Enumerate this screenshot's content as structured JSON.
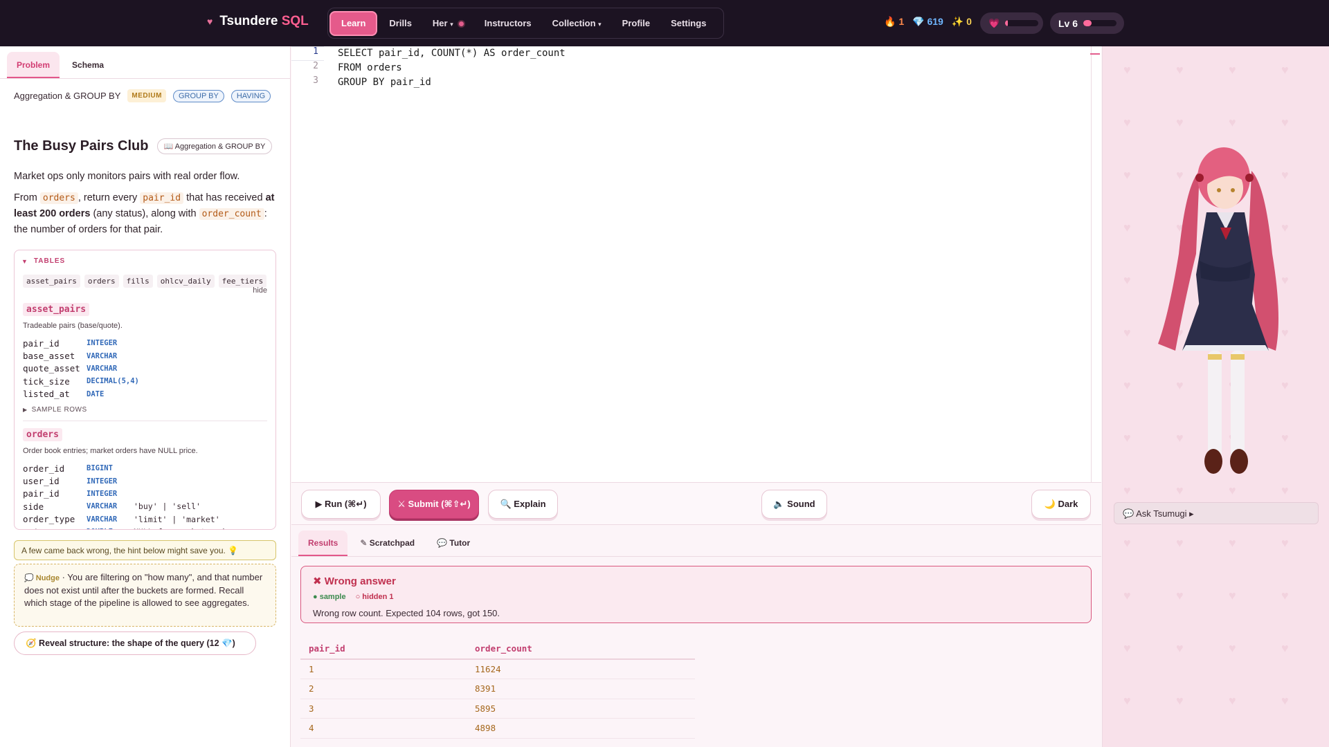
{
  "brand": {
    "name": "Tsundere",
    "suffix": "SQL"
  },
  "nav": {
    "items": [
      "Learn",
      "Drills",
      "Her",
      "Instructors",
      "Collection",
      "Profile",
      "Settings"
    ],
    "active": "Learn"
  },
  "stats": {
    "streak": "1",
    "gems": "619",
    "sparkles": "0"
  },
  "affection": {
    "fraction": 0.08
  },
  "level": {
    "label": "Lv 6",
    "fraction": 0.25
  },
  "left": {
    "tabs": [
      "Problem",
      "Schema"
    ],
    "topic": "Aggregation & GROUP BY",
    "difficulty": "MEDIUM",
    "tags": [
      "GROUP BY",
      "HAVING"
    ],
    "title": "The Busy Pairs Club",
    "topic_badge": "📖 Aggregation & GROUP BY",
    "desc1": "Market ops only monitors pairs with real order flow.",
    "desc2": {
      "from": "From",
      "code1": "orders",
      "mid": ", return every",
      "code2": "pair_id",
      "rest": "that has received",
      "bold": "at least 200 orders",
      "after": "(any status), along with",
      "code3": "order_count",
      "end": ": the number of orders for that pair."
    },
    "tables_header": "TABLES",
    "table_chips": [
      "asset_pairs",
      "orders",
      "fills",
      "ohlcv_daily",
      "fee_tiers"
    ],
    "hide": "hide",
    "t1": {
      "name": "asset_pairs",
      "desc": "Tradeable pairs (base/quote).",
      "cols": [
        [
          "pair_id",
          "INTEGER",
          ""
        ],
        [
          "base_asset",
          "VARCHAR",
          ""
        ],
        [
          "quote_asset",
          "VARCHAR",
          ""
        ],
        [
          "tick_size",
          "DECIMAL(5,4)",
          ""
        ],
        [
          "listed_at",
          "DATE",
          ""
        ]
      ]
    },
    "sample_rows": "SAMPLE ROWS",
    "t2": {
      "name": "orders",
      "desc": "Order book entries; market orders have NULL price.",
      "cols": [
        [
          "order_id",
          "BIGINT",
          ""
        ],
        [
          "user_id",
          "INTEGER",
          ""
        ],
        [
          "pair_id",
          "INTEGER",
          ""
        ],
        [
          "side",
          "VARCHAR",
          "'buy' | 'sell'"
        ],
        [
          "order_type",
          "VARCHAR",
          "'limit' | 'market'"
        ],
        [
          "price",
          "DOUBLE",
          "NULL for market orders"
        ]
      ]
    },
    "warn": "A few came back wrong, the hint below might save you. 💡",
    "nudge_label": "💭 Nudge",
    "nudge": " · You are filtering on \"how many\", and that number does not exist until after the buckets are formed. Recall which stage of the pipeline is allowed to see aggregates.",
    "reveal": "🧭 Reveal structure: the shape of the query (12 💎)"
  },
  "editor": {
    "lines": [
      "SELECT pair_id, COUNT(*) AS order_count",
      "FROM orders",
      "GROUP BY pair_id"
    ],
    "line_numbers": [
      "1",
      "2",
      "3"
    ]
  },
  "toolbar": {
    "run": "▶ Run (⌘↵)",
    "submit": "⚔ Submit (⌘⇧↵)",
    "explain": "🔍 Explain",
    "sound": "🔈 Sound",
    "dark": "🌙 Dark"
  },
  "results": {
    "tabs": [
      "Results",
      "✎ Scratchpad",
      "💬 Tutor"
    ],
    "status": "✖ Wrong answer",
    "sample": "● sample",
    "hidden": "○ hidden 1",
    "message": "Wrong row count. Expected 104 rows, got 150.",
    "columns": [
      "pair_id",
      "order_count"
    ],
    "rows": [
      [
        "1",
        "11624"
      ],
      [
        "2",
        "8391"
      ],
      [
        "3",
        "5895"
      ],
      [
        "4",
        "4898"
      ]
    ]
  },
  "right": {
    "ask": "💬 Ask Tsumugi ▸"
  }
}
